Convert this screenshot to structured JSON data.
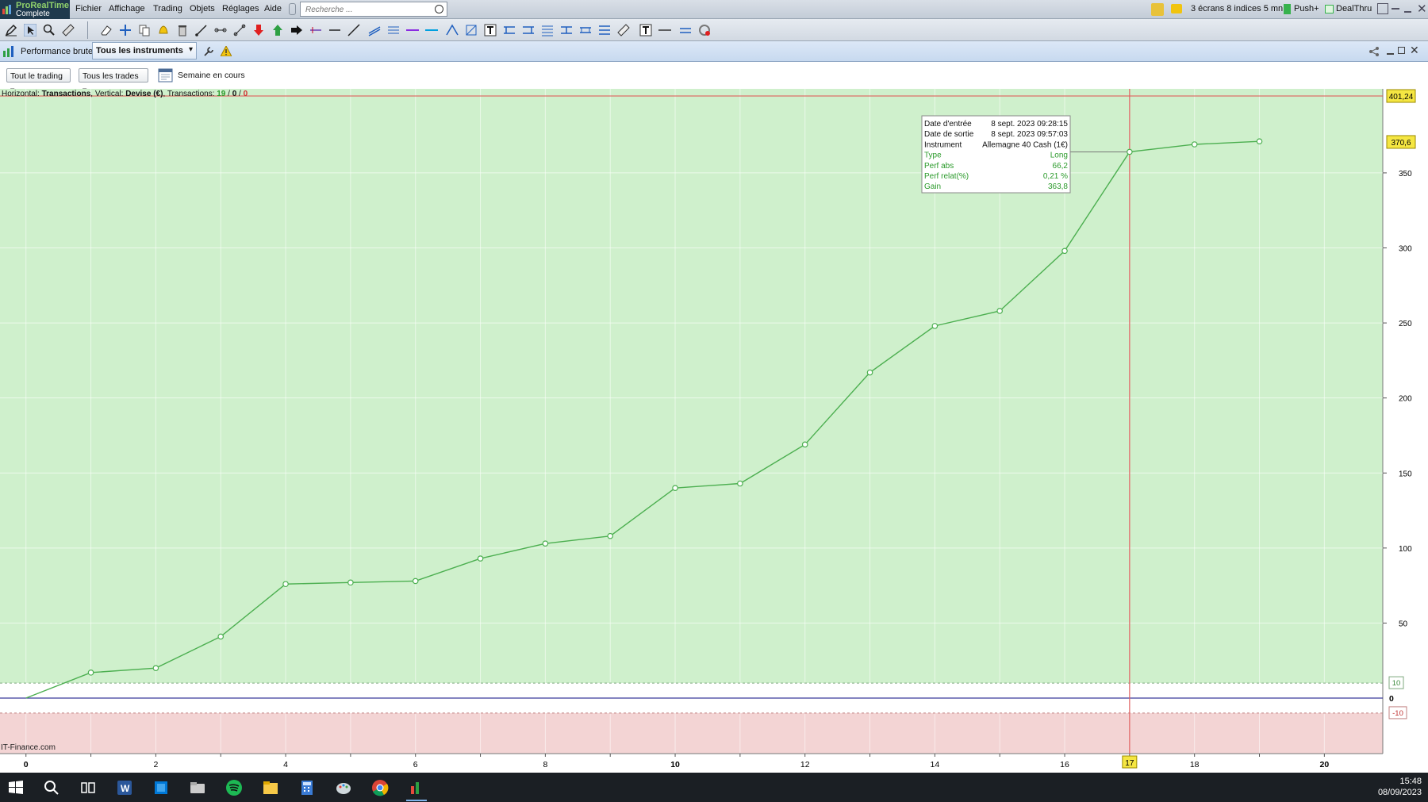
{
  "app": {
    "name": "ProRealTime",
    "edition": "Complete"
  },
  "menu": [
    "Fichier",
    "Affichage",
    "Trading",
    "Objets",
    "Réglages",
    "Aide"
  ],
  "search": {
    "placeholder": "Recherche ..."
  },
  "topright": {
    "screens": "3 écrans 8 indices 5 mn",
    "push": "Push+",
    "dealthru": "DealThru"
  },
  "panel": {
    "title": "Performance brute",
    "instruments": "Tous les instruments"
  },
  "filters": {
    "trading": "Tout le trading",
    "trades": "Tous les trades",
    "period": "Semaine en cours"
  },
  "info": {
    "h_label": "Horizontal:",
    "h_value": "Transactions",
    "v_label": "Vertical:",
    "v_value": "Devise (€)",
    "t_label": "Transactions:",
    "t_win": "19",
    "t_mid": "0",
    "t_loss": "0"
  },
  "tooltip": {
    "rows": [
      {
        "label": "Date d'entrée",
        "value": "8 sept. 2023 09:28:15",
        "color": "#111111"
      },
      {
        "label": "Date de sortie",
        "value": "8 sept. 2023 09:57:03",
        "color": "#111111"
      },
      {
        "label": "Instrument",
        "value": "Allemagne 40 Cash (1€)",
        "color": "#111111"
      },
      {
        "label": "Type",
        "value": "Long",
        "color": "#2a9a2a"
      },
      {
        "label": "Perf abs",
        "value": "66,2",
        "color": "#2a9a2a"
      },
      {
        "label": "Perf relat(%)",
        "value": "0,21 %",
        "color": "#2a9a2a"
      },
      {
        "label": "Gain",
        "value": "363,8",
        "color": "#2a9a2a"
      }
    ]
  },
  "watermark": "IT-Finance.com",
  "clock": {
    "time": "15:48",
    "date": "08/09/2023"
  },
  "chart_data": {
    "type": "line",
    "x": [
      0,
      1,
      2,
      3,
      4,
      5,
      6,
      7,
      8,
      9,
      10,
      11,
      12,
      13,
      14,
      15,
      16,
      17,
      18,
      19
    ],
    "values": [
      0,
      17,
      20,
      41,
      76,
      77,
      78,
      93,
      103,
      108,
      140,
      143,
      169,
      217,
      248,
      258,
      298,
      364,
      369,
      371
    ],
    "xlim": [
      -0.4,
      20.9
    ],
    "ylim": [
      -37,
      406
    ],
    "x_ticks": [
      {
        "v": 0,
        "label": "0",
        "bold": true
      },
      {
        "v": 2,
        "label": "2"
      },
      {
        "v": 4,
        "label": "4"
      },
      {
        "v": 6,
        "label": "6"
      },
      {
        "v": 8,
        "label": "8"
      },
      {
        "v": 10,
        "label": "10",
        "bold": true
      },
      {
        "v": 12,
        "label": "12"
      },
      {
        "v": 14,
        "label": "14"
      },
      {
        "v": 16,
        "label": "16"
      },
      {
        "v": 18,
        "label": "18"
      },
      {
        "v": 20,
        "label": "20",
        "bold": true
      }
    ],
    "y_ticks": [
      {
        "v": 50,
        "label": "50"
      },
      {
        "v": 100,
        "label": "100"
      },
      {
        "v": 150,
        "label": "150"
      },
      {
        "v": 200,
        "label": "200"
      },
      {
        "v": 250,
        "label": "250"
      },
      {
        "v": 300,
        "label": "300"
      },
      {
        "v": 350,
        "label": "350"
      }
    ],
    "zero": {
      "v": 0,
      "label": "0"
    },
    "band_upper": {
      "v": 10,
      "label": "10"
    },
    "band_lower": {
      "v": -10,
      "label": "-10"
    },
    "max_line": {
      "v": 401.24,
      "label": "401,24"
    },
    "last_value": {
      "v": 370.6,
      "label": "370,6"
    },
    "cursor": {
      "x": 17,
      "label": "17"
    },
    "grid": true,
    "colors": {
      "profit_zone": "#cff0cc",
      "loss_zone": "#f3d4d4",
      "line": "#4caf50",
      "zero_line": "#3a3a9a",
      "max_line": "#e05050",
      "cursor": "#e06060",
      "badge": "#f5e642"
    }
  }
}
